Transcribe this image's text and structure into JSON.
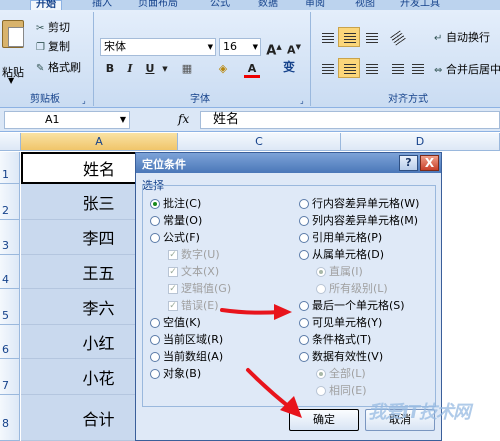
{
  "ribbon": {
    "tabs": [
      "开始",
      "插入",
      "页面布局",
      "公式",
      "数据",
      "审阅",
      "视图",
      "开发工具"
    ],
    "clipboard": {
      "paste": "粘贴",
      "cut": "剪切",
      "copy": "复制",
      "format_painter": "格式刷",
      "group_label": "剪贴板"
    },
    "font": {
      "font_name": "宋体",
      "font_size": "16",
      "grow": "A",
      "shrink": "A",
      "bold": "B",
      "italic": "I",
      "underline": "U",
      "font_color": "A",
      "phonetic": "变",
      "group_label": "字体"
    },
    "alignment": {
      "wrap_text": "自动换行",
      "merge_center": "合并后居中",
      "group_label": "对齐方式"
    }
  },
  "formula_bar": {
    "name_box": "A1",
    "fx": "fx",
    "formula": "姓名"
  },
  "sheet": {
    "columns": [
      "A",
      "C",
      "D"
    ],
    "rows": [
      {
        "num": "1",
        "a": "姓名"
      },
      {
        "num": "2",
        "a": "张三"
      },
      {
        "num": "3",
        "a": "李四"
      },
      {
        "num": "4",
        "a": "王五"
      },
      {
        "num": "5",
        "a": "李六"
      },
      {
        "num": "6",
        "a": "小红"
      },
      {
        "num": "7",
        "a": "小花"
      },
      {
        "num": "8",
        "a": "合计"
      }
    ]
  },
  "dialog": {
    "title": "定位条件",
    "help": "?",
    "close": "X",
    "section": "选择",
    "left_options": [
      "批注(C)",
      "常量(O)",
      "公式(F)",
      "数字(U)",
      "文本(X)",
      "逻辑值(G)",
      "错误(E)",
      "空值(K)",
      "当前区域(R)",
      "当前数组(A)",
      "对象(B)"
    ],
    "right_options": [
      "行内容差异单元格(W)",
      "列内容差异单元格(M)",
      "引用单元格(P)",
      "从属单元格(D)",
      "直属(I)",
      "所有级别(L)",
      "最后一个单元格(S)",
      "可见单元格(Y)",
      "条件格式(T)",
      "数据有效性(V)",
      "全部(L)",
      "相同(E)"
    ],
    "ok": "确定",
    "cancel": "取消"
  },
  "watermark": "我爱IT技术网",
  "colors": {
    "dialog_bg": "#dfe9f7",
    "selection": "#c9d9ee",
    "arrow": "#e8141c",
    "radio_selected": "#1a8a1a"
  },
  "icons": [
    "paste-icon",
    "scissors-icon",
    "copy-icon",
    "brush-icon",
    "fx-icon",
    "help-icon",
    "close-icon",
    "arrow-icon"
  ]
}
